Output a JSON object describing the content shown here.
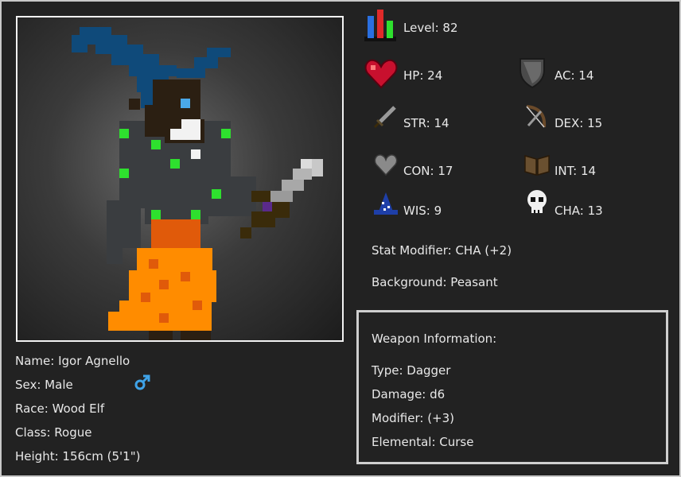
{
  "character": {
    "name": "Name: Igor Agnello",
    "sex": "Sex: Male",
    "race": "Race: Wood Elf",
    "class": "Class: Rogue",
    "height": "Height: 156cm (5'1\")"
  },
  "stats": {
    "level": "Level: 82",
    "hp": "HP: 24",
    "ac": "AC: 14",
    "str": "STR: 14",
    "dex": "DEX: 15",
    "con": "CON: 17",
    "int": "INT: 14",
    "wis": "WIS: 9",
    "cha": "CHA: 13",
    "stat_modifier": "Stat Modifier: CHA (+2)",
    "background": "Background: Peasant"
  },
  "weapon": {
    "header": "Weapon Information:",
    "type": "Type: Dagger",
    "damage": "Damage: d6",
    "modifier": "Modifier: (+3)",
    "elemental": "Elemental: Curse"
  },
  "icons": {
    "level": "level-bars-icon",
    "hp": "heart-icon",
    "ac": "shield-icon",
    "str": "sword-icon",
    "dex": "bow-icon",
    "con": "gray-heart-icon",
    "int": "book-icon",
    "wis": "wizard-hat-icon",
    "cha": "skull-icon",
    "sex": "male-symbol-icon"
  },
  "colors": {
    "background": "#222222",
    "text": "#e8e8e8",
    "male_symbol": "#3fa3e8",
    "hat": "#0f4a7a",
    "robe": "#ff8c00"
  }
}
